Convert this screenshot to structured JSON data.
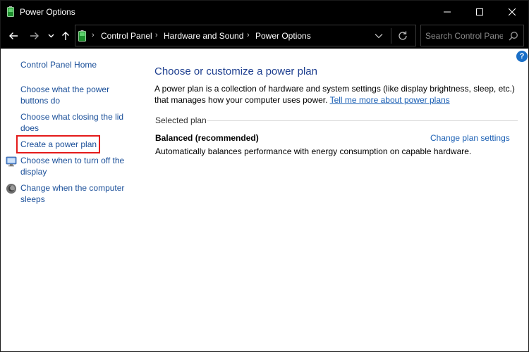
{
  "window": {
    "title": "Power Options"
  },
  "address": {
    "crumbs": [
      "Control Panel",
      "Hardware and Sound",
      "Power Options"
    ]
  },
  "search": {
    "placeholder": "Search Control Panel"
  },
  "help": {
    "label": "?"
  },
  "sidebar": {
    "home": "Control Panel Home",
    "items": [
      {
        "label": "Choose what the power buttons do"
      },
      {
        "label": "Choose what closing the lid does"
      },
      {
        "label": "Create a power plan"
      },
      {
        "label": "Choose when to turn off the display",
        "icon": "display-icon"
      },
      {
        "label": "Change when the computer sleeps",
        "icon": "sleep-icon"
      }
    ]
  },
  "main": {
    "title": "Choose or customize a power plan",
    "description": "A power plan is a collection of hardware and system settings (like display brightness, sleep, etc.) that manages how your computer uses power.",
    "learn_more_link": "Tell me more about power plans",
    "section_label": "Selected plan",
    "plan": {
      "name": "Balanced (recommended)",
      "settings_link": "Change plan settings",
      "description": "Automatically balances performance with energy consumption on capable hardware."
    }
  },
  "colors": {
    "highlight": "#e41a1a",
    "link": "#1a5fb4",
    "title": "#1e3f8f",
    "chrome": "#000000"
  }
}
